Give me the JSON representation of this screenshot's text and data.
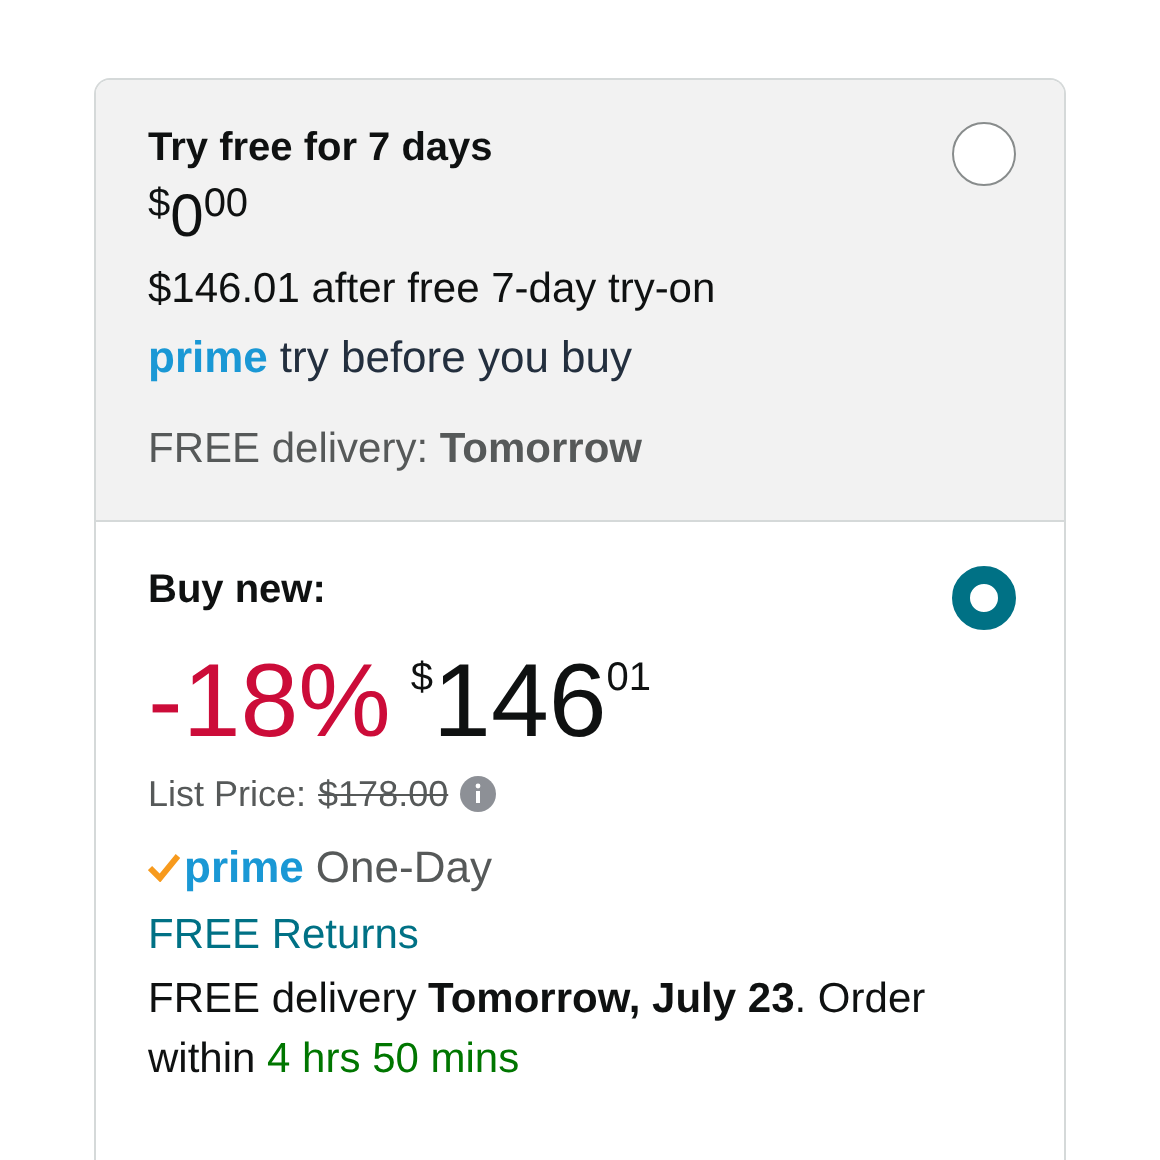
{
  "options": [
    {
      "kind": "trial",
      "selected": false,
      "title": "Try free for 7 days",
      "price": {
        "symbol": "$",
        "whole": "0",
        "fraction": "00"
      },
      "after_trial": "$146.01 after free 7-day try-on",
      "prime_badge": "prime",
      "prime_text": "try before you buy",
      "delivery": "FREE delivery: **Tomorrow**"
    },
    {
      "kind": "buy",
      "selected": true,
      "title": "Buy new:",
      "discount": "-18%",
      "price": {
        "symbol": "$",
        "whole": "146",
        "fraction": "01"
      },
      "list_price_label": "List Price:",
      "list_price": "$178.00",
      "prime_badge": "prime",
      "prime_text": "One-Day",
      "returns": "FREE Returns",
      "delivery": "FREE delivery **Tomorrow, July 23**. Order within",
      "countdown": "4 hrs 50 mins"
    }
  ]
}
